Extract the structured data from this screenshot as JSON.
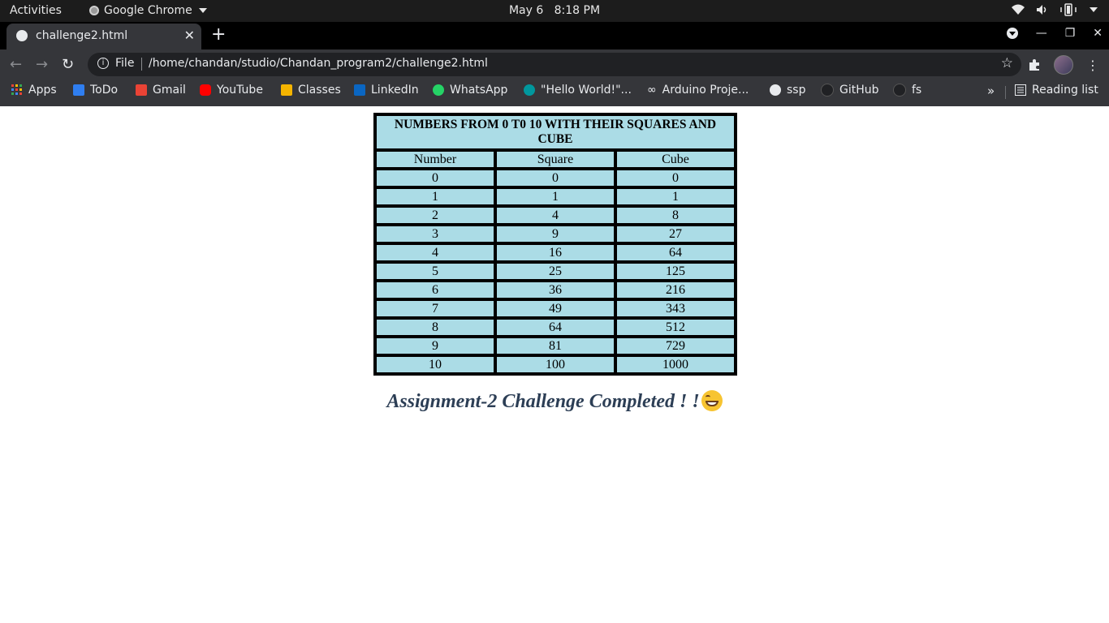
{
  "os_bar": {
    "activities": "Activities",
    "app": "Google Chrome",
    "date": "May 6",
    "time": "8:18 PM"
  },
  "browser": {
    "tab_title": "challenge2.html",
    "scheme_label": "File",
    "url": "/home/chandan/studio/Chandan_program2/challenge2.html",
    "bookmarks": [
      {
        "label": "Apps",
        "icon": "apps-grid-icon",
        "color": "#e94235"
      },
      {
        "label": "ToDo",
        "icon": "todo-check-icon",
        "color": "#2f7ef0"
      },
      {
        "label": "Gmail",
        "icon": "gmail-icon",
        "color": "#ea4335"
      },
      {
        "label": "YouTube",
        "icon": "youtube-icon",
        "color": "#ff0000"
      },
      {
        "label": "Classes",
        "icon": "classroom-icon",
        "color": "#f4b400"
      },
      {
        "label": "LinkedIn",
        "icon": "linkedin-icon",
        "color": "#0a66c2"
      },
      {
        "label": "WhatsApp",
        "icon": "whatsapp-icon",
        "color": "#25d366"
      },
      {
        "label": "\"Hello World!\"...",
        "icon": "arduino-icon",
        "color": "#00979d"
      },
      {
        "label": "Arduino Proje...",
        "icon": "infinity-icon",
        "color": "#e8eaed"
      },
      {
        "label": "ssp",
        "icon": "globe-icon",
        "color": "#e8eaed"
      },
      {
        "label": "GitHub",
        "icon": "github-icon",
        "color": "#202124"
      },
      {
        "label": "fs",
        "icon": "github-icon",
        "color": "#202124"
      }
    ],
    "more_label": "»",
    "reading_list": "Reading list"
  },
  "table": {
    "caption": "NUMBERS FROM 0 T0 10 WITH THEIR SQUARES AND CUBE",
    "headers": [
      "Number",
      "Square",
      "Cube"
    ],
    "rows": [
      [
        "0",
        "0",
        "0"
      ],
      [
        "1",
        "1",
        "1"
      ],
      [
        "2",
        "4",
        "8"
      ],
      [
        "3",
        "9",
        "27"
      ],
      [
        "4",
        "16",
        "64"
      ],
      [
        "5",
        "25",
        "125"
      ],
      [
        "6",
        "36",
        "216"
      ],
      [
        "7",
        "49",
        "343"
      ],
      [
        "8",
        "64",
        "512"
      ],
      [
        "9",
        "81",
        "729"
      ],
      [
        "10",
        "100",
        "1000"
      ]
    ],
    "cell_color": "#abdce6"
  },
  "message": "Assignment-2 Challenge Completed ! !"
}
